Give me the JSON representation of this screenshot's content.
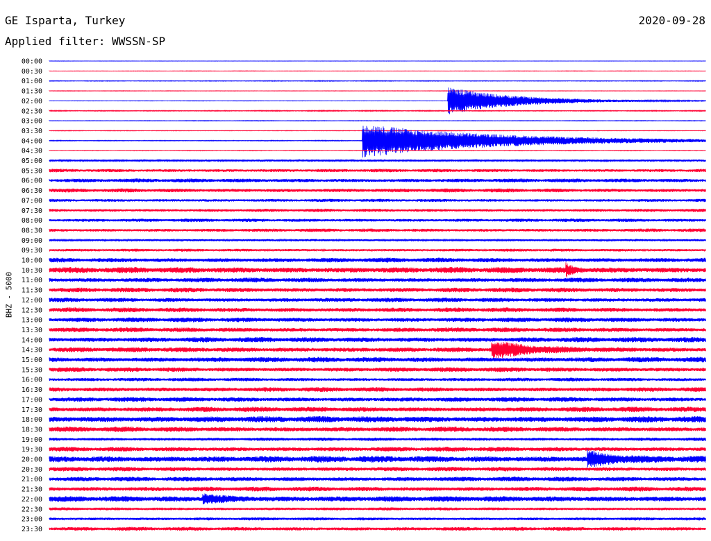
{
  "header": {
    "station": "GE Isparta, Turkey",
    "date": "2020-09-28",
    "filter": "Applied filter: WWSSN-SP"
  },
  "channel_label": "BHZ - 5000",
  "colors": {
    "even_trace": "#0000ff",
    "odd_trace": "#ff0033"
  },
  "chart_data": {
    "type": "seismogram-helicorder",
    "title": "GE Isparta, Turkey",
    "subtitle": "Applied filter: WWSSN-SP",
    "ylabel": "BHZ - 5000",
    "rows": [
      "00:00",
      "00:30",
      "01:00",
      "01:30",
      "02:00",
      "02:30",
      "03:00",
      "03:30",
      "04:00",
      "04:30",
      "05:00",
      "05:30",
      "06:00",
      "06:30",
      "07:00",
      "07:30",
      "08:00",
      "08:30",
      "09:00",
      "09:30",
      "10:00",
      "10:30",
      "11:00",
      "11:30",
      "12:00",
      "12:30",
      "13:00",
      "13:30",
      "14:00",
      "14:30",
      "15:00",
      "15:30",
      "16:00",
      "16:30",
      "17:00",
      "17:30",
      "18:00",
      "18:30",
      "19:00",
      "19:30",
      "20:00",
      "20:30",
      "21:00",
      "21:30",
      "22:00",
      "22:30",
      "23:00",
      "23:30"
    ],
    "row_minutes": 30,
    "noise_amplitude": [
      0.3,
      0.4,
      0.6,
      0.4,
      0.4,
      0.8,
      0.5,
      0.5,
      0.7,
      0.5,
      1.6,
      2.6,
      3.0,
      3.0,
      2.4,
      2.4,
      2.6,
      2.6,
      1.8,
      2.2,
      3.6,
      4.6,
      3.6,
      3.6,
      3.4,
      3.6,
      3.6,
      3.6,
      4.0,
      3.8,
      4.0,
      3.6,
      2.8,
      3.6,
      3.6,
      4.0,
      4.8,
      4.0,
      2.6,
      3.6,
      5.0,
      3.4,
      3.6,
      3.6,
      4.4,
      2.4,
      2.4,
      3.0
    ],
    "events": [
      {
        "row": "02:00",
        "minute_offset": 18.2,
        "peak_amplitude": 20,
        "duration_min": 3.0
      },
      {
        "row": "04:00",
        "minute_offset": 14.3,
        "peak_amplitude": 24,
        "duration_min": 6.0
      },
      {
        "row": "10:30",
        "minute_offset": 23.6,
        "peak_amplitude": 8,
        "duration_min": 0.3
      },
      {
        "row": "14:30",
        "minute_offset": 20.2,
        "peak_amplitude": 12,
        "duration_min": 1.5
      },
      {
        "row": "20:00",
        "minute_offset": 24.6,
        "peak_amplitude": 10,
        "duration_min": 1.2
      },
      {
        "row": "22:00",
        "minute_offset": 7.0,
        "peak_amplitude": 6,
        "duration_min": 1.0
      }
    ]
  }
}
